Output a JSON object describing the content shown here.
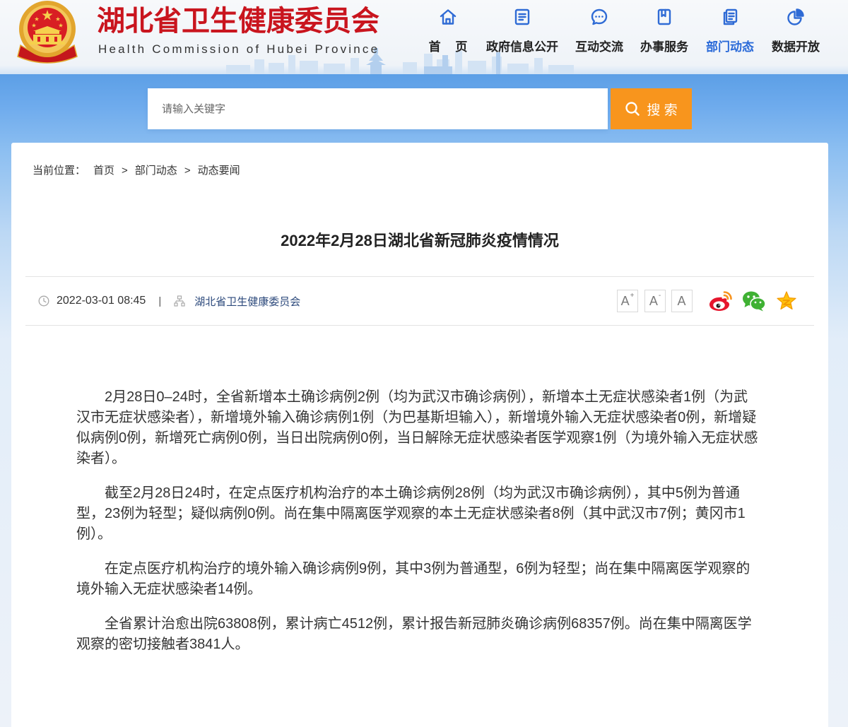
{
  "header": {
    "title": "湖北省卫生健康委员会",
    "subtitle": "Health Commission of Hubei Province",
    "emblem": "national-emblem",
    "nav": [
      {
        "label": "首 页",
        "icon": "home-icon",
        "active": false
      },
      {
        "label": "政府信息公开",
        "icon": "document-icon",
        "active": false
      },
      {
        "label": "互动交流",
        "icon": "chat-bubble-icon",
        "active": false
      },
      {
        "label": "办事服务",
        "icon": "bookmark-icon",
        "active": false
      },
      {
        "label": "部门动态",
        "icon": "news-icon",
        "active": true
      },
      {
        "label": "数据开放",
        "icon": "pie-chart-icon",
        "active": false
      }
    ]
  },
  "search": {
    "placeholder": "请输入关键字",
    "value": "",
    "button_label": "搜 索",
    "button_icon": "search-icon"
  },
  "breadcrumb": {
    "prefix": "当前位置：",
    "separator": ">",
    "items": [
      "首页",
      "部门动态",
      "动态要闻"
    ]
  },
  "article": {
    "title": "2022年2月28日湖北省新冠肺炎疫情情况",
    "date_icon": "clock-icon",
    "date": "2022-03-01 08:45",
    "meta_separator": "|",
    "source_icon": "organization-icon",
    "source": "湖北省卫生健康委员会",
    "font_controls": [
      {
        "letter": "A",
        "mark": "+"
      },
      {
        "letter": "A",
        "mark": "-"
      },
      {
        "letter": "A",
        "mark": ""
      }
    ],
    "share_icons": [
      "weibo-icon",
      "wechat-icon",
      "qzone-icon"
    ],
    "paragraphs": [
      "2月28日0–24时，全省新增本土确诊病例2例（均为武汉市确诊病例），新增本土无症状感染者1例（为武汉市无症状感染者），新增境外输入确诊病例1例（为巴基斯坦输入），新增境外输入无症状感染者0例，新增疑似病例0例，新增死亡病例0例，当日出院病例0例，当日解除无症状感染者医学观察1例（为境外输入无症状感染者）。",
      "截至2月28日24时，在定点医疗机构治疗的本土确诊病例28例（均为武汉市确诊病例），其中5例为普通型，23例为轻型；疑似病例0例。尚在集中隔离医学观察的本土无症状感染者8例（其中武汉市7例；黄冈市1例）。",
      "在定点医疗机构治疗的境外输入确诊病例9例，其中3例为普通型，6例为轻型；尚在集中隔离医学观察的境外输入无症状感染者14例。",
      "全省累计治愈出院63808例，累计病亡4512例，累计报告新冠肺炎确诊病例68357例。尚在集中隔离医学观察的密切接触者3841人。"
    ]
  },
  "colors": {
    "brand_red": "#c9151e",
    "nav_blue": "#2f6bd5",
    "active_blue": "#2a6ad8",
    "search_orange": "#f8951d",
    "weibo_red": "#e6162d",
    "wechat_green": "#3fb133",
    "qzone_yellow": "#ffc20e"
  }
}
